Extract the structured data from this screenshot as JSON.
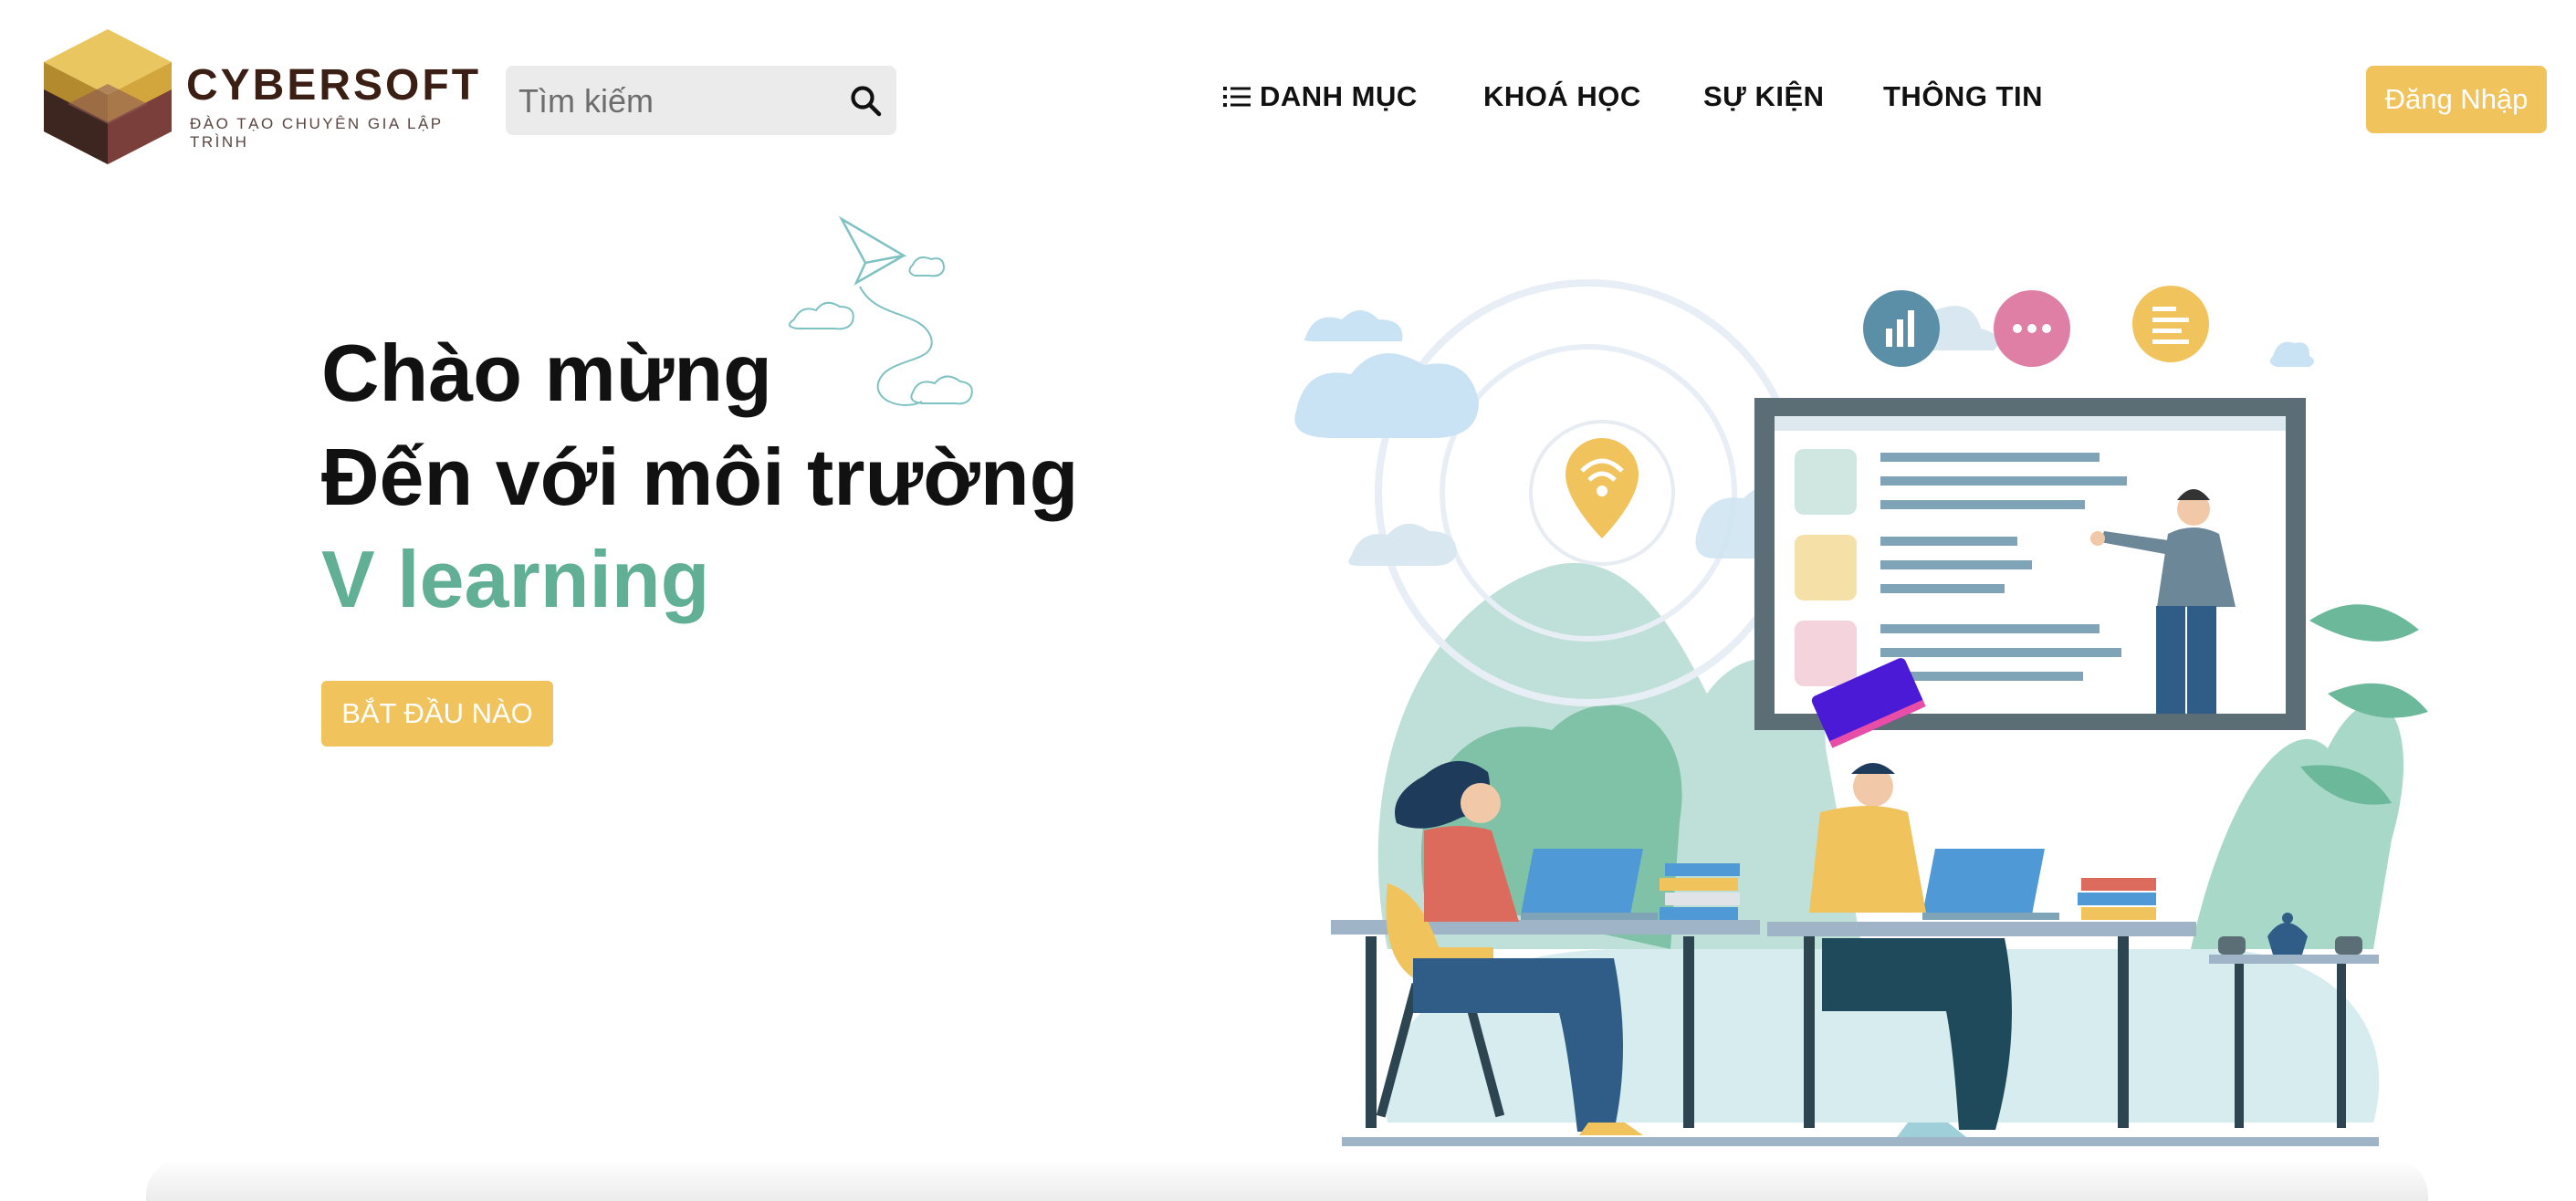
{
  "header": {
    "brand": "CYBERSOFT",
    "tagline": "ĐÀO TẠO CHUYÊN GIA LẬP TRÌNH",
    "search_placeholder": "Tìm kiếm",
    "nav": {
      "danh_muc": "DANH MỤC",
      "khoa_hoc": "KHOÁ HỌC",
      "su_kien": "SỰ KIỆN",
      "thong_tin": "THÔNG TIN"
    },
    "login_label": "Đăng Nhập"
  },
  "hero": {
    "line1": "Chào mừng",
    "line2": "Đến với môi trường",
    "line3": "V learning",
    "cta_label": "BẮT ĐẦU NÀO"
  },
  "colors": {
    "accent_yellow": "#f0c35c",
    "accent_green": "#61b095",
    "brand_brown": "#3b1e14"
  },
  "icons": {
    "search": "search-icon",
    "menu": "list-icon",
    "logo": "cube-logo-icon"
  }
}
